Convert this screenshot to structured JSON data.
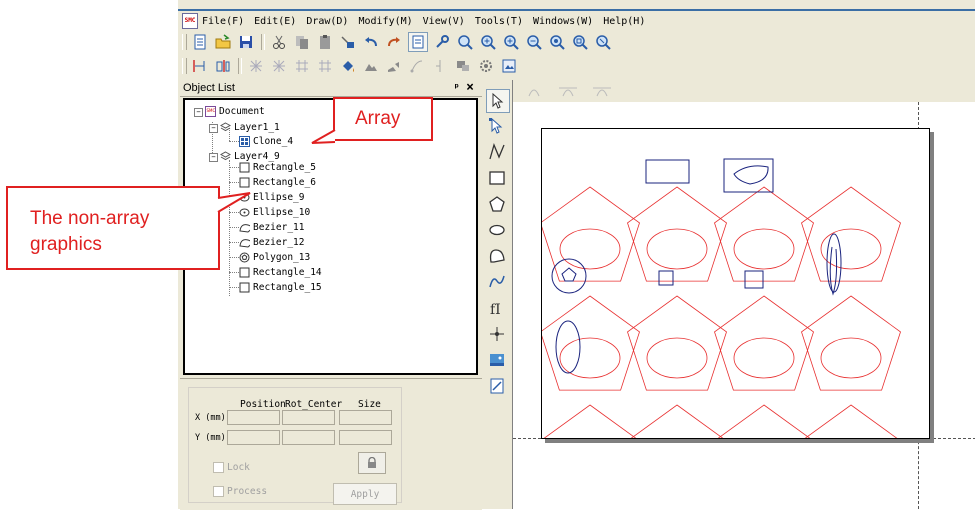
{
  "menu": {
    "items": [
      "File(F)",
      "Edit(E)",
      "Draw(D)",
      "Modify(M)",
      "View(V)",
      "Tools(T)",
      "Windows(W)",
      "Help(H)"
    ],
    "app_icon_text": "SMC"
  },
  "toolbars": {
    "row1_icons": [
      "new-file-icon",
      "open-folder-icon",
      "save-icon",
      "cut-icon",
      "copy-icon",
      "paste-icon",
      "array-copy-icon",
      "undo-icon",
      "redo-icon",
      "object-list-icon",
      "properties-icon",
      "zoom-icon",
      "zoom-in-icon",
      "zoom-in-plus-icon",
      "zoom-out-icon",
      "zoom-all-icon",
      "zoom-page-icon",
      "zoom-fit-icon"
    ],
    "row2_icons": [
      "align-left-icon",
      "align-right-icon",
      "grid-a-icon",
      "grid-b-icon",
      "grid-c-icon",
      "grid-d-icon",
      "fill-icon",
      "shape-icon",
      "transform-icon",
      "path-icon",
      "node-icon",
      "group-icon",
      "settings-icon",
      "image-icon"
    ]
  },
  "object_list": {
    "title": "Object List",
    "pin": "ᵖ",
    "close": "×",
    "document": "Document",
    "layers": [
      {
        "name": "Layer1_1",
        "children": [
          "Clone_4"
        ]
      },
      {
        "name": "Layer4_9",
        "children": [
          "Rectangle_5",
          "Rectangle_6",
          "Ellipse_9",
          "Ellipse_10",
          "Bezier_11",
          "Bezier_12",
          "Polygon_13",
          "Rectangle_14",
          "Rectangle_15"
        ]
      }
    ]
  },
  "properties": {
    "col_position": "Position",
    "col_rot_center": "Rot_Center",
    "col_size": "Size",
    "row_x": "X (mm)",
    "row_y": "Y (mm)",
    "lock_label": "Lock",
    "process_label": "Process",
    "apply_label": "Apply"
  },
  "annotations": {
    "array": "Array",
    "non_array_line1": "The non-array",
    "non_array_line2": "graphics"
  },
  "colors": {
    "accent_red": "#e02020",
    "pattern_red": "#e83030",
    "shape_blue": "#1a237e"
  }
}
